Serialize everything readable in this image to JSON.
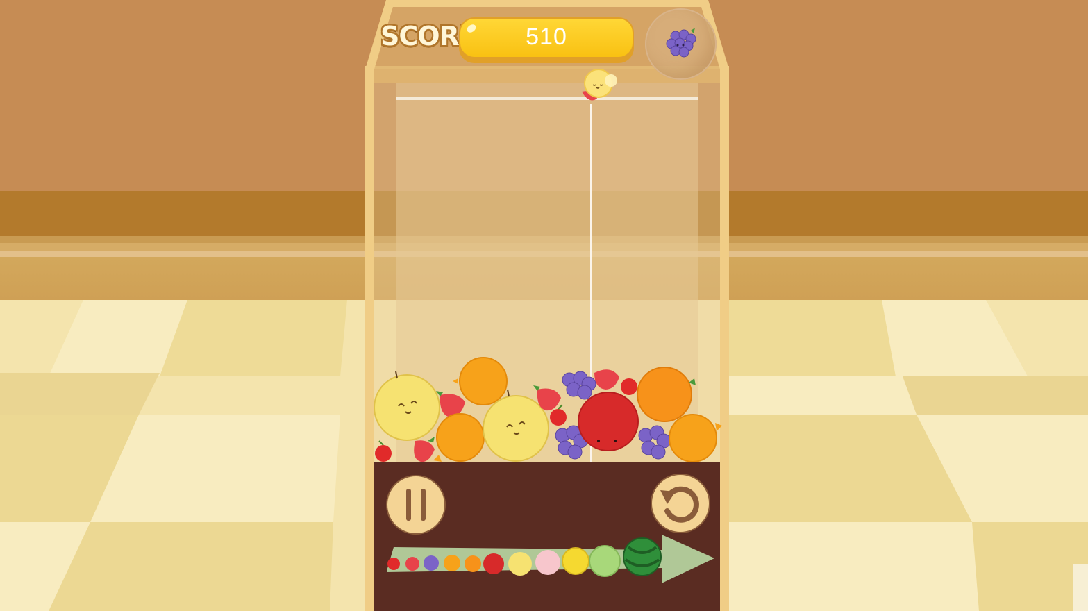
{
  "score": {
    "label": "SCORE",
    "value": "510"
  },
  "next_fruit": "grape",
  "held_fruit": "pineapple",
  "board_fruits": [
    "pear",
    "orange",
    "strawberry",
    "orange",
    "pear",
    "strawberry",
    "cherry",
    "strawberry",
    "cherry",
    "grape",
    "strawberry",
    "cherry",
    "apple",
    "orange",
    "grape",
    "grape",
    "orange",
    "cherry",
    "strawberry"
  ],
  "evolution_chain": [
    "cherry",
    "strawberry",
    "grape",
    "dekopon",
    "orange",
    "apple",
    "pear",
    "peach",
    "pineapple",
    "melon",
    "watermelon"
  ],
  "controls": {
    "pause": "pause-icon",
    "restart": "restart-icon"
  },
  "colors": {
    "score_bar": "#f9c112",
    "panel": "#5a2c22",
    "button_face": "#f4d495",
    "jar_frame": "#f0cd86"
  }
}
